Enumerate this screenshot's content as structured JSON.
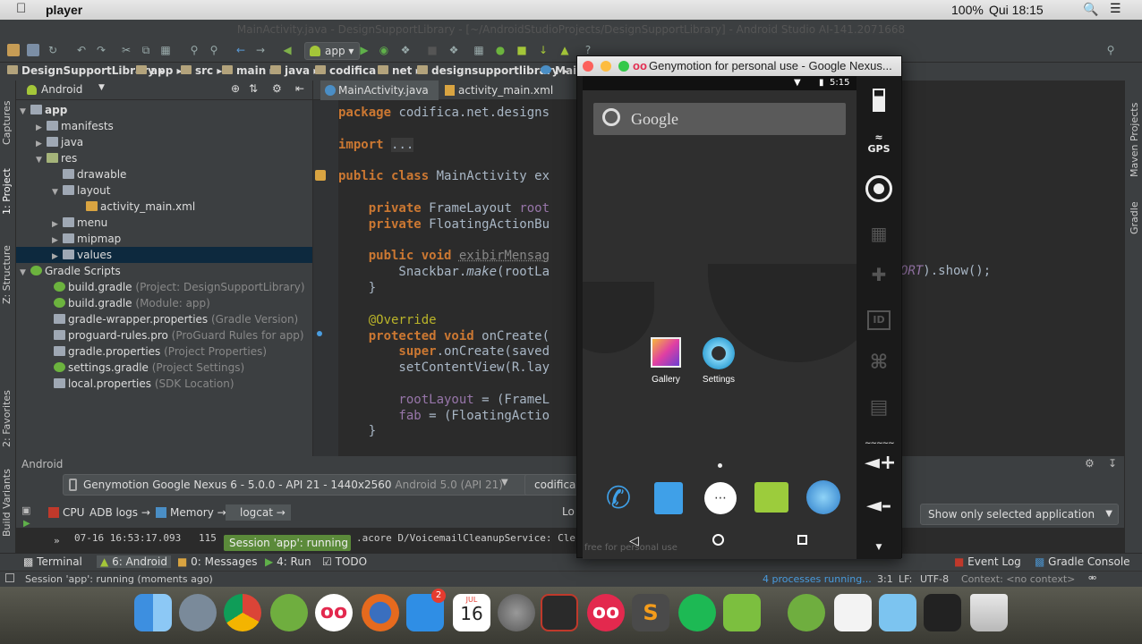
{
  "mac_menubar": {
    "app_name": "player",
    "battery": "100%",
    "clock": "Qui 18:15"
  },
  "window_title": "MainActivity.java - DesignSupportLibrary - [~/AndroidStudioProjects/DesignSupportLibrary] - Android Studio AI-141.2071668",
  "toolbar": {
    "run_config": "app"
  },
  "breadcrumbs": [
    "DesignSupportLibrary",
    "app",
    "src",
    "main",
    "java",
    "codifica",
    "net",
    "designsupportlibrary",
    "Main"
  ],
  "project_panel": {
    "view": "Android",
    "tree": [
      {
        "label": "app",
        "extra": ""
      },
      {
        "label": "manifests",
        "extra": ""
      },
      {
        "label": "java",
        "extra": ""
      },
      {
        "label": "res",
        "extra": ""
      },
      {
        "label": "drawable",
        "extra": ""
      },
      {
        "label": "layout",
        "extra": ""
      },
      {
        "label": "activity_main.xml",
        "extra": ""
      },
      {
        "label": "menu",
        "extra": ""
      },
      {
        "label": "mipmap",
        "extra": ""
      },
      {
        "label": "values",
        "extra": ""
      },
      {
        "label": "Gradle Scripts",
        "extra": ""
      },
      {
        "label": "build.gradle",
        "extra": "(Project: DesignSupportLibrary)"
      },
      {
        "label": "build.gradle",
        "extra": "(Module: app)"
      },
      {
        "label": "gradle-wrapper.properties",
        "extra": "(Gradle Version)"
      },
      {
        "label": "proguard-rules.pro",
        "extra": "(ProGuard Rules for app)"
      },
      {
        "label": "gradle.properties",
        "extra": "(Project Properties)"
      },
      {
        "label": "settings.gradle",
        "extra": "(Project Settings)"
      },
      {
        "label": "local.properties",
        "extra": "(SDK Location)"
      }
    ]
  },
  "side_tabs": {
    "captures": "Captures",
    "project": "1: Project",
    "structure": "Z: Structure",
    "favorites": "2: Favorites",
    "build_variants": "Build Variants",
    "maven": "Maven Projects",
    "gradle": "Gradle"
  },
  "editor_tabs": [
    "MainActivity.java",
    "activity_main.xml"
  ],
  "code": {
    "l1a": "package ",
    "l1b": "codifica.net.designs",
    "l2a": "import ",
    "l2b": "...",
    "l3a": "public class ",
    "l3b": "MainActivity ex",
    "l4a": "    private ",
    "l4b": "FrameLayout ",
    "l4c": "root",
    "l5a": "    private ",
    "l5b": "FloatingActionBu",
    "l6a": "    public void ",
    "l6b": "exibirMensag",
    "l7a": "        Snackbar.",
    "l7b": "make",
    "l7c": "(rootLa",
    "l8": "    }",
    "l9": "    @Override",
    "l10a": "    protected void ",
    "l10b": "onCreate(",
    "l11a": "        super",
    "l11b": ".onCreate(saved",
    "l12": "        setContentView(R.lay",
    "l13a": "        rootLayout",
    "l13b": " = (FrameL",
    "l14a": "        fab",
    "l14b": " = (FloatingActio",
    "l15": "    }",
    "right_a": "ORT",
    "right_b": ").show();"
  },
  "android_panel": {
    "title": "Android",
    "device": "Genymotion Google Nexus 6 - 5.0.0 - API 21 - 1440x2560",
    "device_api": "Android 5.0 (API 21)",
    "package": "codifica",
    "tabs": [
      "CPU",
      "ADB logs",
      "Memory",
      "logcat"
    ],
    "log_level": "Lo",
    "filter": "Show only selected application",
    "log_time": "07-16 16:53:17.093",
    "log_pid": "115",
    "log_text": ".acore D/VoicemailCleanupService: Cle",
    "toast": "Session 'app': running"
  },
  "tool_windows": {
    "terminal": "Terminal",
    "android": "6: Android",
    "messages": "0: Messages",
    "run": "4: Run",
    "todo": "TODO",
    "event_log": "Event Log",
    "gradle_console": "Gradle Console"
  },
  "status_bar": {
    "message": "Session 'app': running (moments ago)",
    "processes": "4 processes running...",
    "position": "3:1",
    "line_sep": "LF:",
    "encoding": "UTF-8",
    "context": "Context: <no context>"
  },
  "genymotion": {
    "title": "Genymotion for personal use - Google Nexus...",
    "time": "5:15",
    "search": "Google",
    "apps": [
      "Gallery",
      "Settings"
    ],
    "watermark": "free for personal use",
    "side_buttons": [
      "battery",
      "GPS",
      "camera",
      "video",
      "dpad",
      "ID",
      "rss",
      "sms",
      "volume-up",
      "volume-down"
    ],
    "gps_label": "GPS",
    "id_label": "ID"
  },
  "dock": {
    "calendar_month": "JUL",
    "calendar_day": "16",
    "badge": "2"
  },
  "colors": {
    "accent": "#4a9de0",
    "android_green": "#a4c639",
    "selection": "#0d293e"
  }
}
